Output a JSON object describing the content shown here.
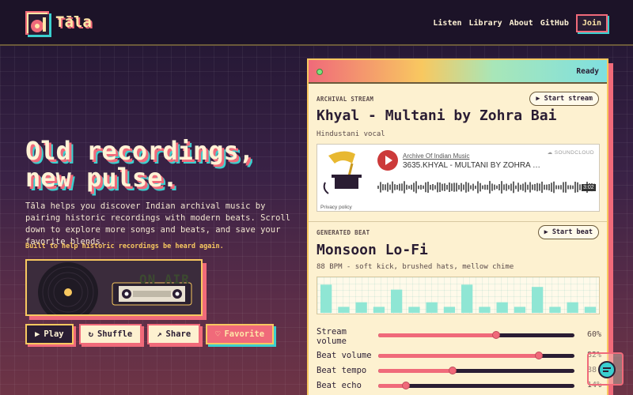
{
  "header": {
    "brand": "Tāla",
    "logo_icon": "record-pen-logo-icon",
    "nav": [
      "Listen",
      "Library",
      "About",
      "GitHub"
    ],
    "join_label": "Join"
  },
  "hero": {
    "title_line1": "Old recordings,",
    "title_line2": "new pulse.",
    "description": "Tāla helps you discover Indian archival music by pairing historic recordings with modern beats. Scroll down to explore more songs and beats, and save your favorite blends.",
    "note": "Built to help historic recordings be heard again.",
    "deck_display": "ON AIR",
    "buttons": {
      "play": "Play",
      "play_icon": "▶",
      "shuffle": "Shuffle",
      "shuffle_icon": "↻",
      "share": "Share",
      "share_icon": "↗",
      "favorite": "Favorite",
      "favorite_icon": "♡"
    }
  },
  "panel": {
    "status": "Ready",
    "archival": {
      "label": "ARCHIVAL STREAM",
      "button": "▶ Start stream",
      "title": "Khyal - Multani by Zohra Bai",
      "subtitle": "Hindustani vocal",
      "embed": {
        "artist": "Archive Of Indian Music",
        "track": "3635.KHYAL - MULTANI BY ZOHRA BA...",
        "brand": "SOUNDCLOUD",
        "duration": "3:02",
        "privacy": "Privacy policy"
      }
    },
    "beat": {
      "label": "GENERATED BEAT",
      "button": "▶ Start beat",
      "title": "Monsoon Lo-Fi",
      "subtitle": "88 BPM - soft kick, brushed hats, mellow chime",
      "bar_levels": [
        0.85,
        0.18,
        0.32,
        0.18,
        0.7,
        0.18,
        0.32,
        0.18,
        0.85,
        0.18,
        0.32,
        0.18,
        0.78,
        0.18,
        0.32,
        0.18
      ]
    },
    "sliders": [
      {
        "label": "Stream volume",
        "value": 0.6,
        "display": "60%"
      },
      {
        "label": "Beat volume",
        "value": 0.82,
        "display": "82%"
      },
      {
        "label": "Beat tempo",
        "value": 0.38,
        "display": "88"
      },
      {
        "label": "Beat echo",
        "value": 0.14,
        "display": "14%"
      }
    ]
  },
  "colors": {
    "accent_pink": "#f06a7a",
    "accent_yellow": "#f8c860",
    "accent_teal": "#3ad0d0",
    "cream": "#fdf1d0",
    "ink": "#2a1d33"
  }
}
